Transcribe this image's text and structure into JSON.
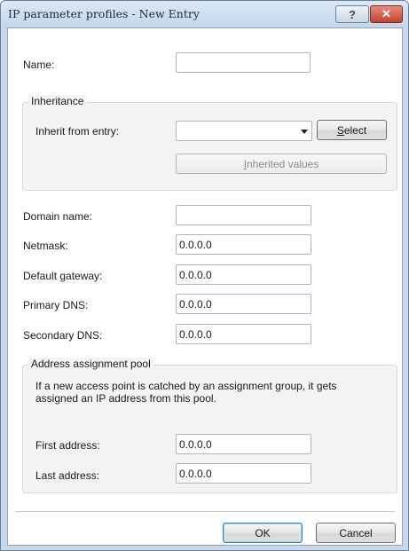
{
  "window": {
    "title": "IP parameter profiles - New Entry",
    "help_label": "?",
    "close_label": "✕"
  },
  "form": {
    "name": {
      "label": "Name:",
      "value": ""
    },
    "inheritance": {
      "title": "Inheritance",
      "inherit_from_label": "Inherit from entry:",
      "inherit_from_value": "",
      "select_button": {
        "pre": "",
        "mnemonic": "S",
        "post": "elect"
      },
      "inherited_values_button": {
        "pre": "",
        "mnemonic": "I",
        "post": "nherited values"
      }
    },
    "domain_name": {
      "label": "Domain name:",
      "value": ""
    },
    "netmask": {
      "label": "Netmask:",
      "value": "0.0.0.0"
    },
    "default_gateway": {
      "label": "Default gateway:",
      "value": "0.0.0.0"
    },
    "primary_dns": {
      "label": "Primary DNS:",
      "value": "0.0.0.0"
    },
    "secondary_dns": {
      "label": "Secondary DNS:",
      "value": "0.0.0.0"
    },
    "pool": {
      "title": "Address assignment pool",
      "note_line1": "If a new access point is catched by an assignment group, it gets",
      "note_line2": "assigned an IP address from this pool.",
      "first_address": {
        "label": "First address:",
        "value": "0.0.0.0"
      },
      "last_address": {
        "label": "Last address:",
        "value": "0.0.0.0"
      }
    }
  },
  "footer": {
    "ok_label": "OK",
    "cancel_label": "Cancel"
  }
}
